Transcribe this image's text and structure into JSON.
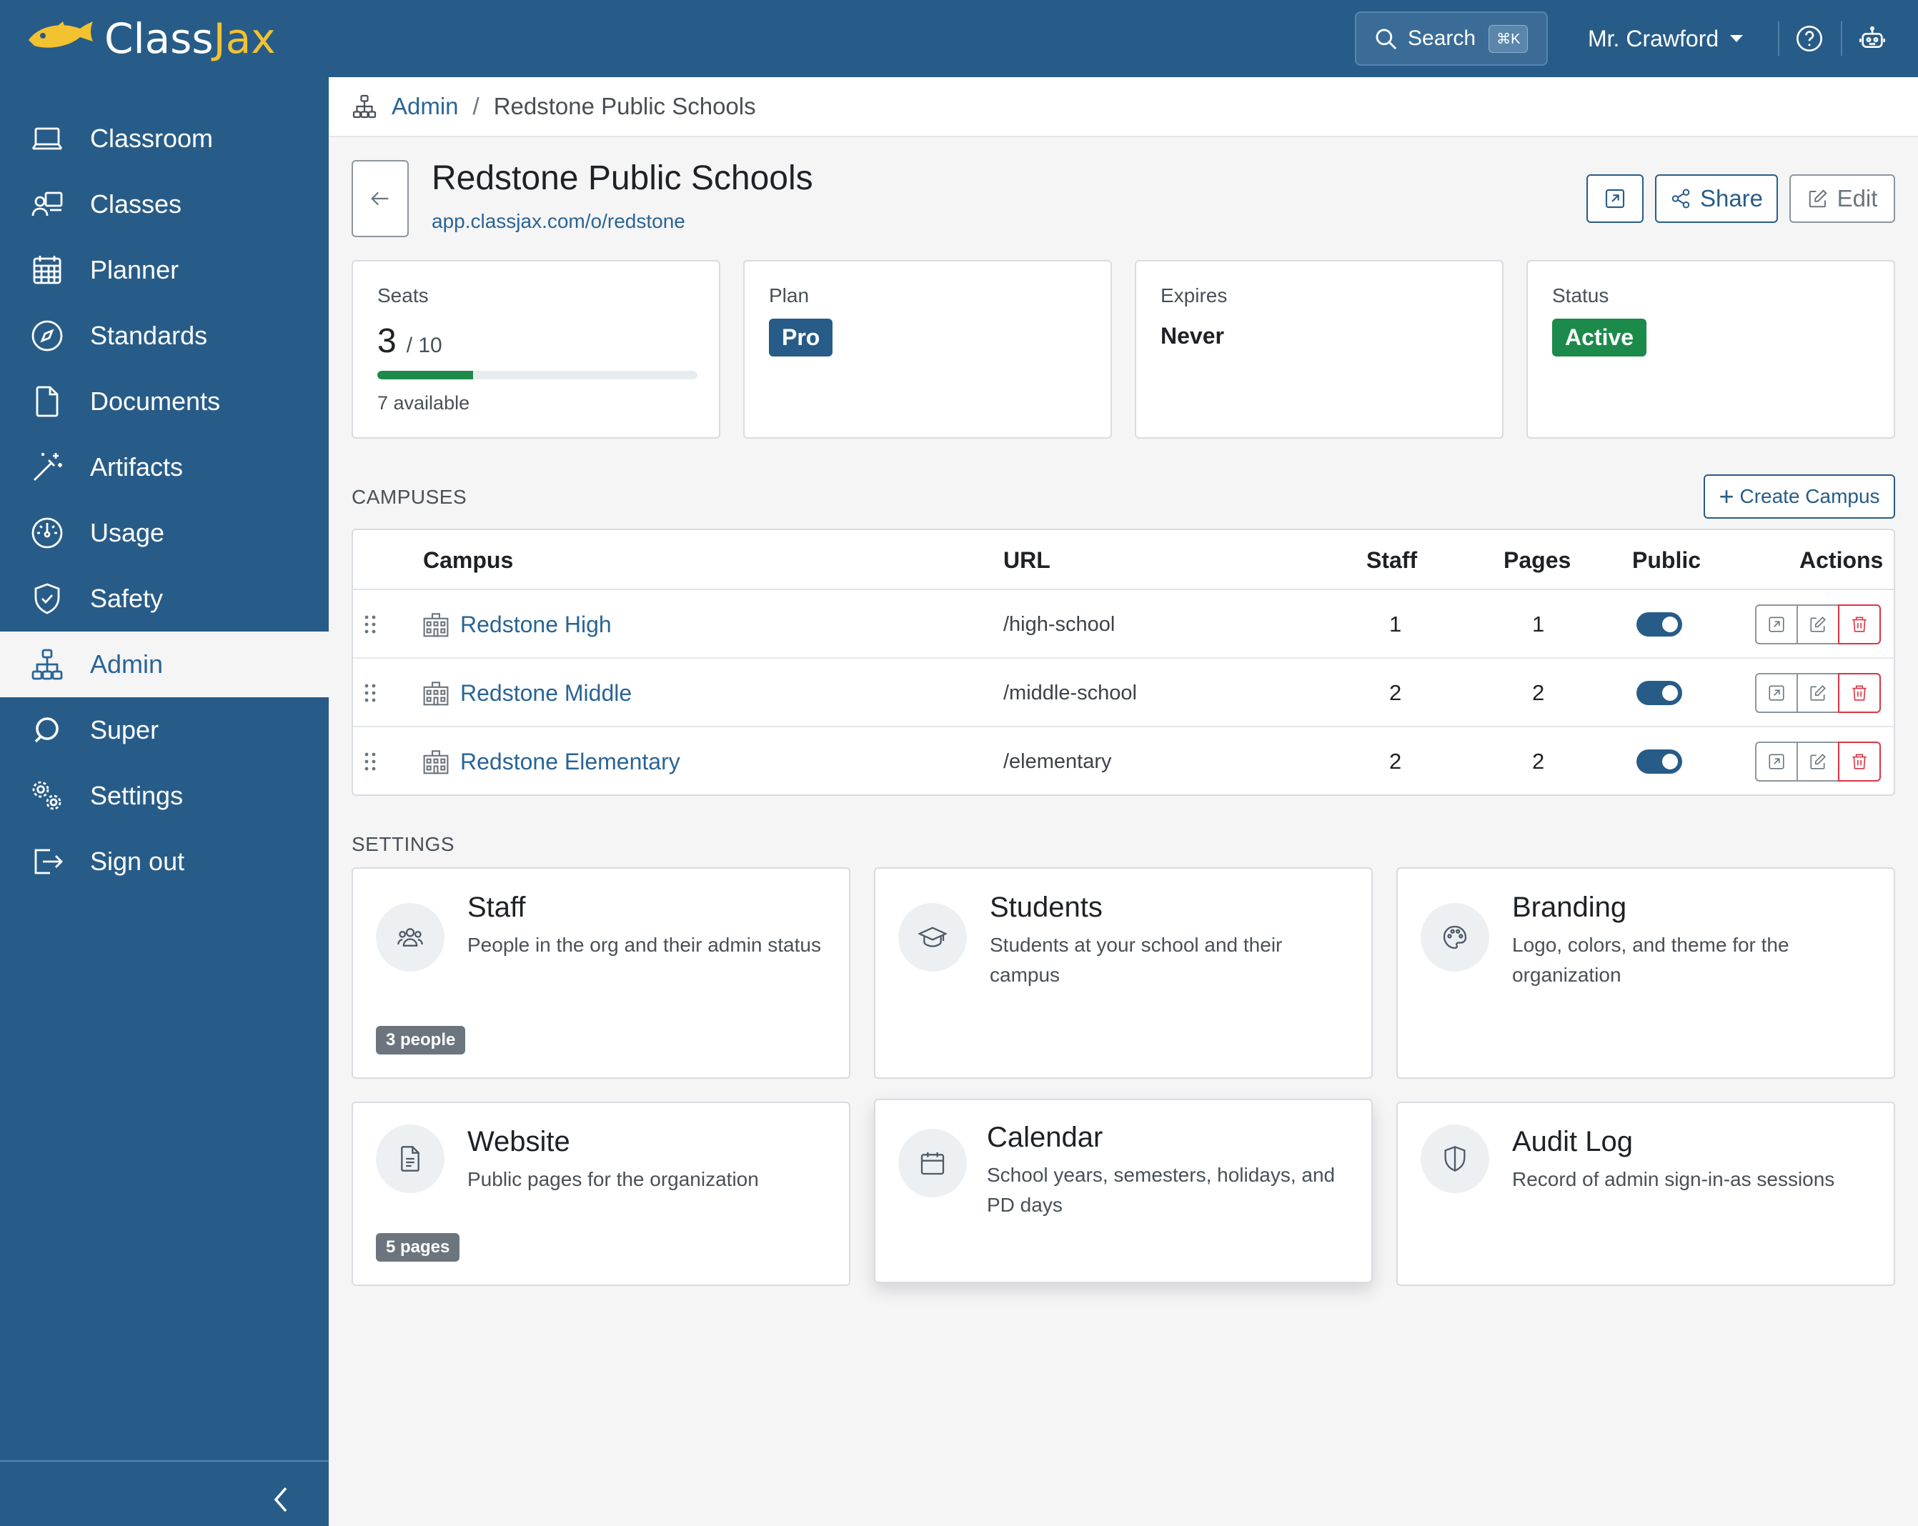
{
  "brand": {
    "name_part1": "Class",
    "name_part2": "Jax",
    "logo_icon": "fish-logo",
    "accent": "#f2c230"
  },
  "topbar": {
    "search_label": "Search",
    "search_shortcut": "⌘K",
    "user_name": "Mr. Crawford",
    "help_icon": "question-circle-icon",
    "assistant_icon": "robot-icon",
    "background": "#285c88"
  },
  "sidebar": {
    "items": [
      {
        "label": "Classroom",
        "icon": "laptop-icon"
      },
      {
        "label": "Classes",
        "icon": "person-board-icon"
      },
      {
        "label": "Planner",
        "icon": "calendar-grid-icon"
      },
      {
        "label": "Standards",
        "icon": "compass-icon"
      },
      {
        "label": "Documents",
        "icon": "file-icon"
      },
      {
        "label": "Artifacts",
        "icon": "magic-wand-icon"
      },
      {
        "label": "Usage",
        "icon": "speedometer-icon"
      },
      {
        "label": "Safety",
        "icon": "shield-check-icon"
      },
      {
        "label": "Admin",
        "icon": "diagram-icon",
        "active": true
      },
      {
        "label": "Super",
        "icon": "orbit-icon"
      },
      {
        "label": "Settings",
        "icon": "gears-icon"
      },
      {
        "label": "Sign out",
        "icon": "box-arrow-right-icon"
      }
    ],
    "collapse_icon": "chevron-left-icon"
  },
  "breadcrumb": {
    "root": "Admin",
    "current": "Redstone Public Schools",
    "icon": "diagram-icon"
  },
  "org": {
    "title": "Redstone Public Schools",
    "url": "app.classjax.com/o/redstone",
    "share_label": "Share",
    "edit_label": "Edit"
  },
  "stats": {
    "seats": {
      "label": "Seats",
      "used": "3",
      "total": "/ 10",
      "available": "7 available",
      "progress_fraction": 0.3
    },
    "plan": {
      "label": "Plan",
      "value": "Pro",
      "color": "#285c88"
    },
    "expires": {
      "label": "Expires",
      "value": "Never"
    },
    "status": {
      "label": "Status",
      "value": "Active",
      "color": "#1c8a4a"
    }
  },
  "campuses": {
    "section_label": "CAMPUSES",
    "create_label": "Create Campus",
    "columns": {
      "campus": "Campus",
      "url": "URL",
      "staff": "Staff",
      "pages": "Pages",
      "public": "Public",
      "actions": "Actions"
    },
    "rows": [
      {
        "name": "Redstone High",
        "url": "/high-school",
        "staff": "1",
        "pages": "1",
        "public": true
      },
      {
        "name": "Redstone Middle",
        "url": "/middle-school",
        "staff": "2",
        "pages": "2",
        "public": true
      },
      {
        "name": "Redstone Elementary",
        "url": "/elementary",
        "staff": "2",
        "pages": "2",
        "public": true
      }
    ]
  },
  "settings": {
    "section_label": "SETTINGS",
    "cards": [
      {
        "title": "Staff",
        "desc": "People in the org and their admin status",
        "badge": "3 people",
        "icon": "people-icon"
      },
      {
        "title": "Students",
        "desc": "Students at your school and their campus",
        "icon": "mortarboard-icon"
      },
      {
        "title": "Branding",
        "desc": "Logo, colors, and theme for the organization",
        "icon": "palette-icon"
      },
      {
        "title": "Website",
        "desc": "Public pages for the organization",
        "badge": "5 pages",
        "icon": "document-icon"
      },
      {
        "title": "Calendar",
        "desc": "School years, semesters, holidays, and PD days",
        "icon": "calendar-icon"
      },
      {
        "title": "Audit Log",
        "desc": "Record of admin sign-in-as sessions",
        "icon": "shield-half-icon"
      }
    ]
  }
}
